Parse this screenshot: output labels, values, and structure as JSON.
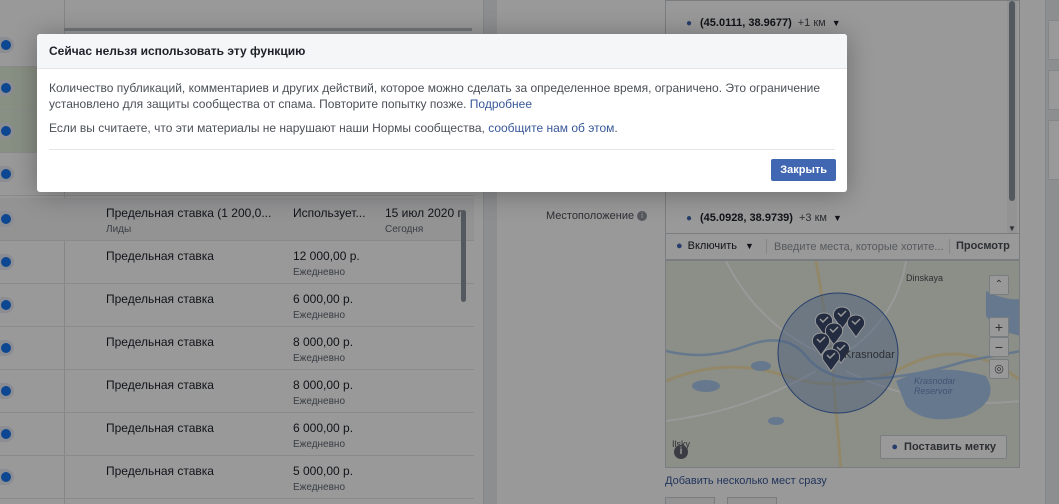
{
  "table": {
    "rows": [
      {
        "bid": "Предельная ставка (1 200,0...",
        "bid_sub": "Лиды",
        "amount": "Использует...",
        "freq": "",
        "date": "15 июл 2020 г.",
        "date_sub": "Сегодня"
      },
      {
        "bid": "Предельная ставка",
        "bid_sub": "",
        "amount": "12 000,00 р.",
        "freq": "Ежедневно",
        "date": "",
        "date_sub": ""
      },
      {
        "bid": "Предельная ставка",
        "bid_sub": "",
        "amount": "6 000,00 р.",
        "freq": "Ежедневно",
        "date": "",
        "date_sub": ""
      },
      {
        "bid": "Предельная ставка",
        "bid_sub": "",
        "amount": "8 000,00 р.",
        "freq": "Ежедневно",
        "date": "",
        "date_sub": ""
      },
      {
        "bid": "Предельная ставка",
        "bid_sub": "",
        "amount": "8 000,00 р.",
        "freq": "Ежедневно",
        "date": "",
        "date_sub": ""
      },
      {
        "bid": "Предельная ставка",
        "bid_sub": "",
        "amount": "6 000,00 р.",
        "freq": "Ежедневно",
        "date": "",
        "date_sub": ""
      },
      {
        "bid": "Предельная ставка",
        "bid_sub": "",
        "amount": "5 000,00 р.",
        "freq": "Ежедневно",
        "date": "",
        "date_sub": ""
      }
    ]
  },
  "targeting": {
    "location_label": "Местоположение",
    "coords": [
      {
        "coord": "(45.0111, 38.9677)",
        "radius": "+1 км"
      },
      {
        "coord": "(45.0928, 38.9739)",
        "radius": "+3 км"
      }
    ],
    "include_label": "Включить",
    "search_placeholder": "Введите места, которые хотите...",
    "browse_label": "Просмотр",
    "map_labels": {
      "city": "Krasnodar",
      "dinskaya": "Dinskaya",
      "reservoir": "Krasnodar Reservoir",
      "ilsky": "Ilsky"
    },
    "drop_pin_label": "Поставить метку",
    "add_multiple_label": "Добавить несколько мест сразу"
  },
  "dialog": {
    "title": "Сейчас нельзя использовать эту функцию",
    "paragraph1": "Количество публикаций, комментариев и других действий, которое можно сделать за определенное время, ограничено. Это ограничение установлено для защиты сообщества от спама. Повторите попытку позже.",
    "learn_more": "Подробнее",
    "paragraph2": "Если вы считаете, что эти материалы не нарушают наши Нормы сообщества,",
    "report_link": "сообщите нам об этом",
    "close_label": "Закрыть"
  },
  "colors": {
    "primary": "#4267b2",
    "link": "#385898",
    "toggle_on": "#1877f2",
    "overlay": "rgba(0,0,0,0.40)"
  },
  "icons": [
    "pin-icon",
    "info-icon",
    "caret-down-icon",
    "zoom-in-icon",
    "zoom-out-icon",
    "locate-icon",
    "collapse-up-icon"
  ]
}
